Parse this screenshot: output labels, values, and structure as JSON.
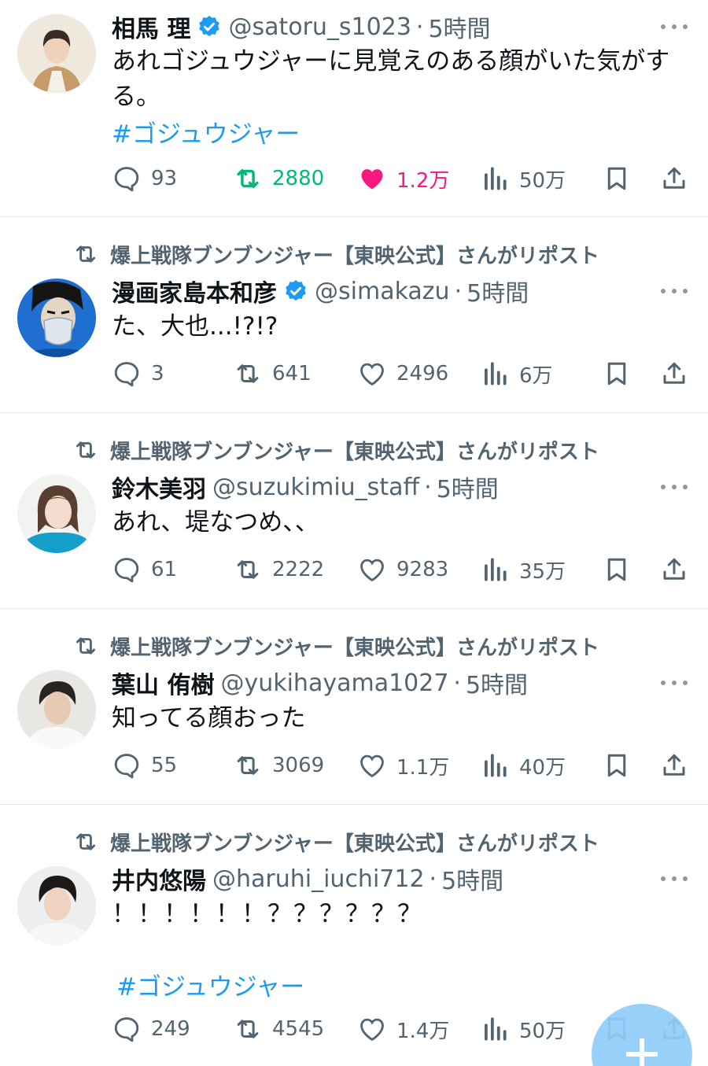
{
  "colors": {
    "link": "#1d9bf0",
    "retweet_active": "#00ba7c",
    "like_active": "#f91880",
    "muted": "#536471"
  },
  "tweets": [
    {
      "name": "相馬 理",
      "verified": true,
      "handle": "@satoru_s1023",
      "dot": "·",
      "time": "5時間",
      "text": "あれゴジュウジャーに見覚えのある顔がいた気がする。",
      "hashtag": "#ゴジュウジャー",
      "replies": "93",
      "reposts": "2880",
      "likes": "1.2万",
      "views": "50万",
      "reposted": true,
      "liked": true
    },
    {
      "repost_by": "爆上戦隊ブンブンジャー【東映公式】さんがリポスト",
      "name": "漫画家島本和彦",
      "verified": true,
      "handle": "@simakazu",
      "dot": "·",
      "time": "5時間",
      "text": "た、大也...!?!?",
      "replies": "3",
      "reposts": "641",
      "likes": "2496",
      "views": "6万"
    },
    {
      "repost_by": "爆上戦隊ブンブンジャー【東映公式】さんがリポスト",
      "name": "鈴木美羽",
      "verified": false,
      "handle": "@suzukimiu_staff",
      "dot": "·",
      "time": "5時間",
      "text": "あれ、堤なつめ、、",
      "replies": "61",
      "reposts": "2222",
      "likes": "9283",
      "views": "35万"
    },
    {
      "repost_by": "爆上戦隊ブンブンジャー【東映公式】さんがリポスト",
      "name": "葉山 侑樹",
      "verified": false,
      "handle": "@yukihayama1027",
      "dot": "·",
      "time": "5時間",
      "text": "知ってる顔おった",
      "replies": "55",
      "reposts": "3069",
      "likes": "1.1万",
      "views": "40万"
    },
    {
      "repost_by": "爆上戦隊ブンブンジャー【東映公式】さんがリポスト",
      "name": "井内悠陽",
      "verified": false,
      "handle": "@haruhi_iuchi712",
      "dot": "·",
      "time": "5時間",
      "text": "！！！！！！？？？？？？",
      "hashtag": "#ゴジュウジャー",
      "replies": "249",
      "reposts": "4545",
      "likes": "1.4万",
      "views": "50万"
    }
  ],
  "icons": {
    "reply": "reply-icon",
    "repost": "repost-icon",
    "like": "heart-icon",
    "views": "views-icon",
    "bookmark": "bookmark-icon",
    "share": "share-icon",
    "more": "more-icon",
    "verified": "verified-badge-icon",
    "compose": "compose-plus-icon"
  }
}
